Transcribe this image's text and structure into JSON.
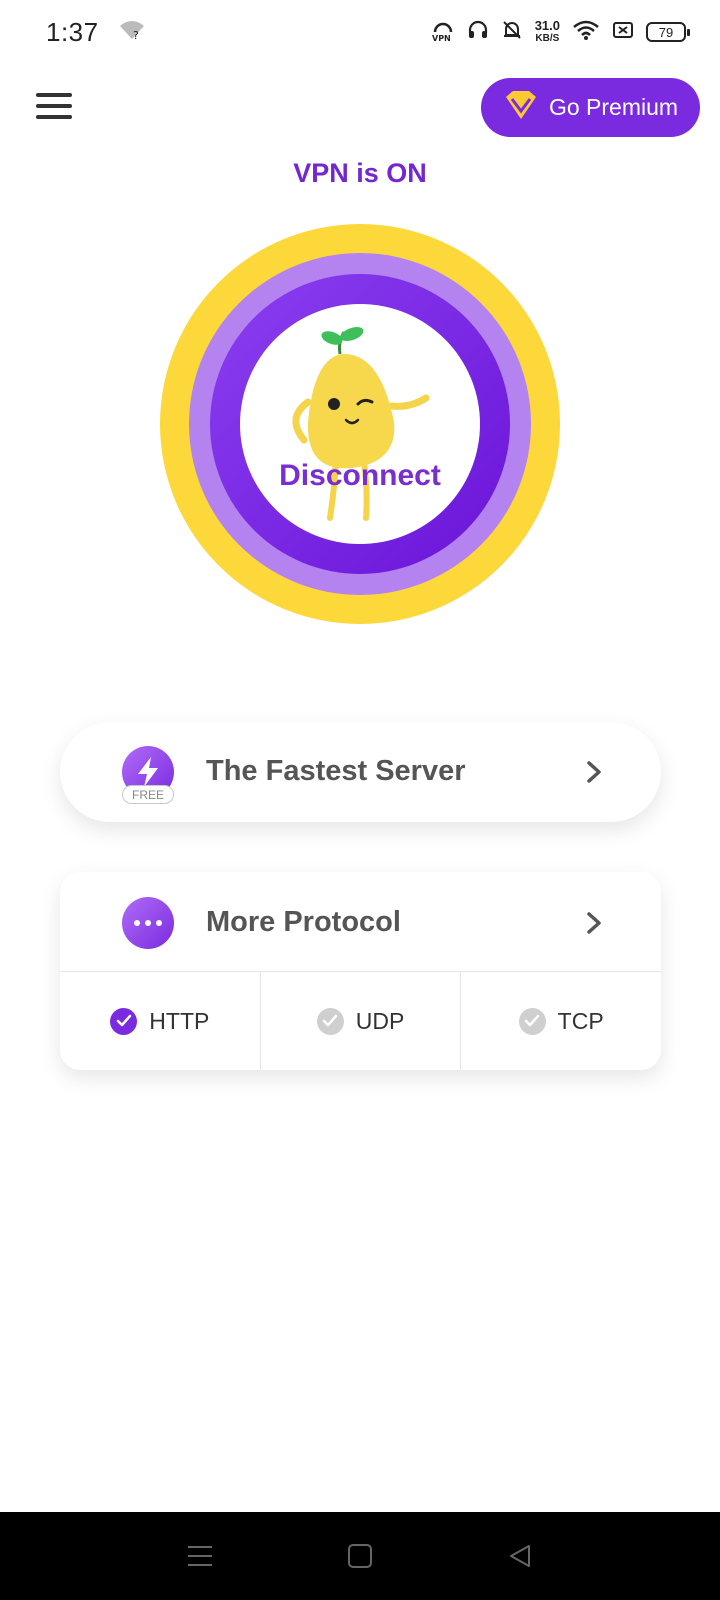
{
  "status_bar": {
    "time": "1:37",
    "speed_value": "31.0",
    "speed_unit": "KB/S",
    "battery": "79"
  },
  "header": {
    "premium_label": "Go Premium"
  },
  "connection": {
    "status_text": "VPN is ON",
    "button_label": "Disconnect"
  },
  "server": {
    "title": "The Fastest Server",
    "badge": "FREE"
  },
  "protocol": {
    "title": "More Protocol",
    "options": [
      {
        "label": "HTTP",
        "selected": true
      },
      {
        "label": "UDP",
        "selected": false
      },
      {
        "label": "TCP",
        "selected": false
      }
    ]
  },
  "colors": {
    "accent": "#7a2be0",
    "ring_yellow": "#fcd83a",
    "ring_light_purple": "#b483f0"
  }
}
